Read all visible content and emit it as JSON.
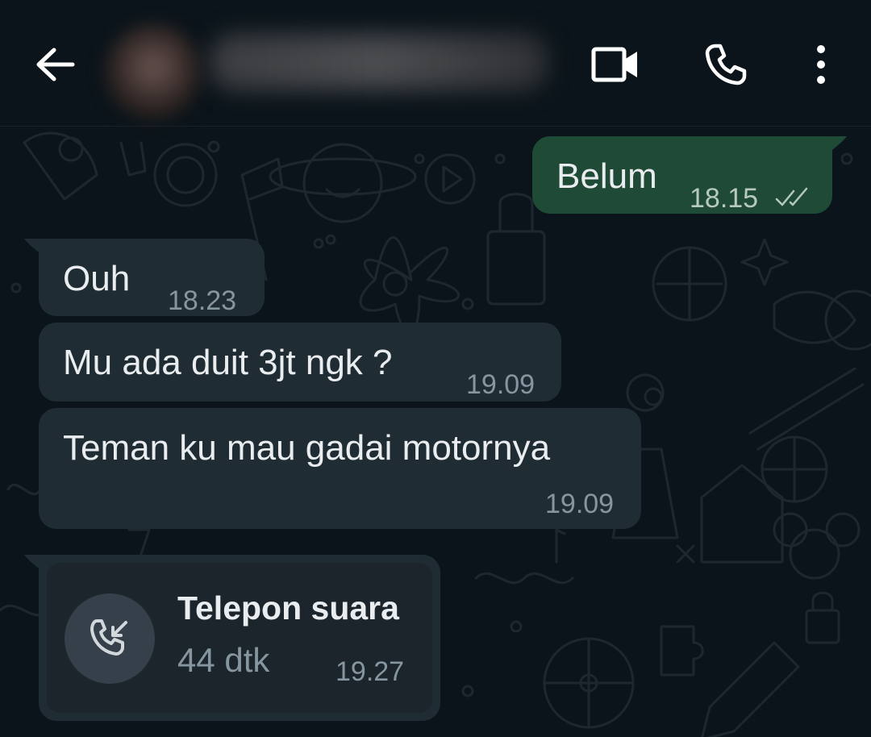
{
  "header": {
    "contact_name": "",
    "icons": {
      "back": "back-arrow-icon",
      "video": "video-camera-icon",
      "call": "phone-icon",
      "menu": "more-vertical-icon"
    }
  },
  "messages": [
    {
      "direction": "outgoing",
      "text": "Belum",
      "time": "18.15",
      "status": "read-double-check"
    },
    {
      "direction": "incoming",
      "text": "Ouh",
      "time": "18.23"
    },
    {
      "direction": "incoming",
      "text": "Mu ada duit 3jt ngk ?",
      "time": "19.09"
    },
    {
      "direction": "incoming",
      "text": "Teman ku mau gadai motornya",
      "time": "19.09"
    }
  ],
  "call": {
    "title": "Telepon suara",
    "duration": "44 dtk",
    "time": "19.27",
    "icon": "incoming-call-icon"
  },
  "colors": {
    "background": "#0b141a",
    "incoming_bubble": "#202c33",
    "outgoing_bubble": "#1f4a36",
    "text": "#e9edef",
    "timestamp": "#8696a0"
  }
}
